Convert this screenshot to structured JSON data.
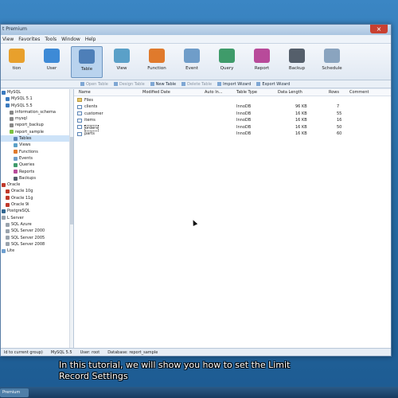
{
  "window": {
    "title": "t Premium",
    "close_label": "×"
  },
  "menu": [
    "View",
    "Favorites",
    "Tools",
    "Window",
    "Help"
  ],
  "toolbar": [
    {
      "label": "tion",
      "icon": "connection-icon",
      "color": "#e8a02c"
    },
    {
      "label": "User",
      "icon": "user-icon",
      "color": "#3d8ad6"
    },
    {
      "label": "Table",
      "icon": "table-icon",
      "color": "#4e7fb8",
      "active": true
    },
    {
      "label": "View",
      "icon": "view-icon",
      "color": "#5aa0c8"
    },
    {
      "label": "Function",
      "icon": "function-icon",
      "color": "#e07a2c"
    },
    {
      "label": "Event",
      "icon": "event-icon",
      "color": "#6f9dc9"
    },
    {
      "label": "Query",
      "icon": "query-icon",
      "color": "#3f9b6a"
    },
    {
      "label": "Report",
      "icon": "report-icon",
      "color": "#b84a9a"
    },
    {
      "label": "Backup",
      "icon": "backup-icon",
      "color": "#555f6b"
    },
    {
      "label": "Schedule",
      "icon": "schedule-icon",
      "color": "#8aa4bf"
    }
  ],
  "objectbar": [
    "Open Table",
    "Design Table",
    "New Table",
    "Delete Table",
    "Import Wizard",
    "Export Wizard"
  ],
  "tree": [
    {
      "label": "MySQL",
      "indent": 0,
      "color": "#3c7bbf"
    },
    {
      "label": "MySQL 5.1",
      "indent": 1,
      "color": "#3c7bbf"
    },
    {
      "label": "MySQL 5.5",
      "indent": 1,
      "color": "#3c7bbf"
    },
    {
      "label": "information_schema",
      "indent": 2,
      "color": "#888"
    },
    {
      "label": "mysql",
      "indent": 2,
      "color": "#888"
    },
    {
      "label": "report_backup",
      "indent": 2,
      "color": "#888"
    },
    {
      "label": "report_sample",
      "indent": 2,
      "color": "#7cc241"
    },
    {
      "label": "Tables",
      "indent": 3,
      "color": "#5d86b6",
      "selected": true
    },
    {
      "label": "Views",
      "indent": 3,
      "color": "#5aa0c8"
    },
    {
      "label": "Functions",
      "indent": 3,
      "color": "#e07a2c"
    },
    {
      "label": "Events",
      "indent": 3,
      "color": "#6f9dc9"
    },
    {
      "label": "Queries",
      "indent": 3,
      "color": "#3f9b6a"
    },
    {
      "label": "Reports",
      "indent": 3,
      "color": "#b84a9a"
    },
    {
      "label": "Backups",
      "indent": 3,
      "color": "#555f6b"
    },
    {
      "label": "Oracle",
      "indent": 0,
      "color": "#c0392b"
    },
    {
      "label": "Oracle 10g",
      "indent": 1,
      "color": "#c0392b"
    },
    {
      "label": "Oracle 11g",
      "indent": 1,
      "color": "#c0392b"
    },
    {
      "label": "Oracle 9i",
      "indent": 1,
      "color": "#c0392b"
    },
    {
      "label": "PostgreSQL",
      "indent": 0,
      "color": "#336791"
    },
    {
      "label": "L Server",
      "indent": 0,
      "color": "#9aa3ad"
    },
    {
      "label": "SQL Azure",
      "indent": 1,
      "color": "#9aa3ad"
    },
    {
      "label": "SQL Server 2000",
      "indent": 1,
      "color": "#9aa3ad"
    },
    {
      "label": "SQL Server 2005",
      "indent": 1,
      "color": "#9aa3ad"
    },
    {
      "label": "SQL Server 2008",
      "indent": 1,
      "color": "#9aa3ad"
    },
    {
      "label": "Lite",
      "indent": 0,
      "color": "#6fa0d0"
    }
  ],
  "table": {
    "columns": [
      "Name",
      "Modified Date",
      "Auto In...",
      "Table Type",
      "Data Length",
      "Rows",
      "Comment"
    ],
    "rows": [
      {
        "name": "Files",
        "folder": true,
        "type": "",
        "length": "",
        "rows": ""
      },
      {
        "name": "clients",
        "type": "InnoDB",
        "length": "96 KB",
        "rows": "7"
      },
      {
        "name": "customer",
        "type": "InnoDB",
        "length": "16 KB",
        "rows": "55"
      },
      {
        "name": "items",
        "type": "InnoDB",
        "length": "16 KB",
        "rows": "16"
      },
      {
        "name": "orders",
        "type": "InnoDB",
        "length": "16 KB",
        "rows": "50",
        "selected": true
      },
      {
        "name": "parts",
        "type": "InnoDB",
        "length": "16 KB",
        "rows": "60"
      }
    ]
  },
  "status": [
    "ld to current group)",
    "MySQL 5.5",
    "User: root",
    "Database: report_sample"
  ],
  "subtitle": {
    "line1": "In this tutorial, we will show you how to set the Limit",
    "line2": "Record Settings"
  },
  "taskbar": {
    "item": "Premium"
  }
}
